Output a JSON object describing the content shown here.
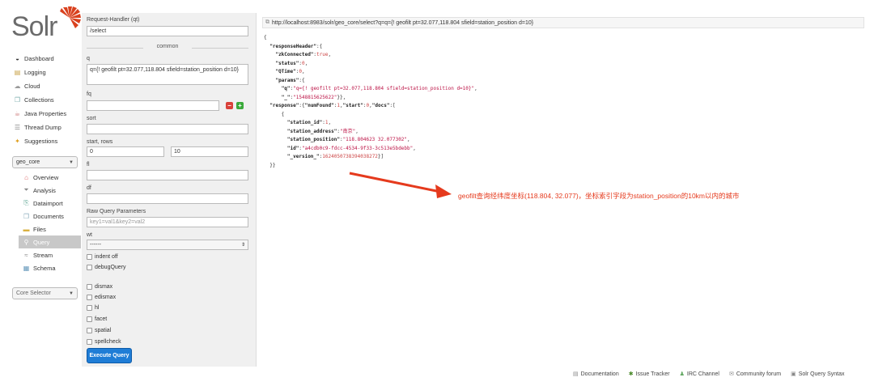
{
  "app": {
    "logo_text": "Solr"
  },
  "nav": [
    {
      "label": "Dashboard",
      "icon": "dashboard-icon"
    },
    {
      "label": "Logging",
      "icon": "logging-icon"
    },
    {
      "label": "Cloud",
      "icon": "cloud-icon"
    },
    {
      "label": "Collections",
      "icon": "collections-icon"
    },
    {
      "label": "Java Properties",
      "icon": "java-icon"
    },
    {
      "label": "Thread Dump",
      "icon": "thread-dump-icon"
    },
    {
      "label": "Suggestions",
      "icon": "suggestions-icon"
    }
  ],
  "core_select": {
    "value": "geo_core"
  },
  "core_nav": [
    {
      "label": "Overview",
      "icon": "overview-icon"
    },
    {
      "label": "Analysis",
      "icon": "analysis-icon"
    },
    {
      "label": "Dataimport",
      "icon": "dataimport-icon"
    },
    {
      "label": "Documents",
      "icon": "documents-icon"
    },
    {
      "label": "Files",
      "icon": "files-icon"
    },
    {
      "label": "Query",
      "icon": "query-icon"
    },
    {
      "label": "Stream",
      "icon": "stream-icon"
    },
    {
      "label": "Schema",
      "icon": "schema-icon"
    }
  ],
  "core_selector": {
    "placeholder": "Core Selector"
  },
  "form": {
    "qt_label": "Request-Handler (qt)",
    "qt_value": "/select",
    "common_label": "common",
    "q_label": "q",
    "q_value": "q={! geofilt pt=32.077,118.804 sfield=station_position d=10}",
    "fq_label": "fq",
    "fq_value": "",
    "sort_label": "sort",
    "sort_value": "",
    "start_rows_label": "start, rows",
    "start_value": "0",
    "rows_value": "10",
    "fl_label": "fl",
    "fl_value": "",
    "df_label": "df",
    "df_value": "",
    "raw_label": "Raw Query Parameters",
    "raw_placeholder": "key1=val1&key2=val2",
    "wt_label": "wt",
    "wt_value": "------",
    "indent_off": "indent off",
    "debug_query": "debugQuery",
    "dismax": "dismax",
    "edismax": "edismax",
    "hl": "hl",
    "facet": "facet",
    "spatial": "spatial",
    "spellcheck": "spellcheck",
    "execute_label": "Execute Query"
  },
  "result": {
    "url": "http://localhost:8983/solr/geo_core/select?q=q={! geofilt pt=32.077,118.804 sfield=station_position d=10}",
    "json_lines": [
      "{",
      "  \"responseHeader\":{",
      "    \"zkConnected\":true,",
      "    \"status\":0,",
      "    \"QTime\":0,",
      "    \"params\":{",
      "      \"q\":\"q={! geofilt pt=32.077,118.804 sfield=station_position d=10}\",",
      "      \"_\":\"1548815625622\"}},",
      "  \"response\":{\"numFound\":1,\"start\":0,\"docs\":[",
      "      {",
      "        \"station_id\":1,",
      "        \"station_address\":\"南京\",",
      "        \"station_position\":\"118.804623 32.077302\",",
      "        \"id\":\"a4cdb0c9-fdcc-4534-9f33-3c513e5bdebb\",",
      "        \"_version_\":1624050738394038272}]",
      "  }}"
    ]
  },
  "annotation": "geofilt查询经纬度坐标(118.804, 32.077)，坐标索引字段为station_position的10km以内的城市",
  "footer": [
    {
      "label": "Documentation",
      "icon": "documentation-icon"
    },
    {
      "label": "Issue Tracker",
      "icon": "bug-icon"
    },
    {
      "label": "IRC Channel",
      "icon": "irc-icon"
    },
    {
      "label": "Community forum",
      "icon": "mail-icon"
    },
    {
      "label": "Solr Query Syntax",
      "icon": "syntax-icon"
    }
  ],
  "colors": {
    "accent": "#1f7dd6",
    "annotation": "#e53a1d",
    "logo_red": "#d9411e"
  }
}
